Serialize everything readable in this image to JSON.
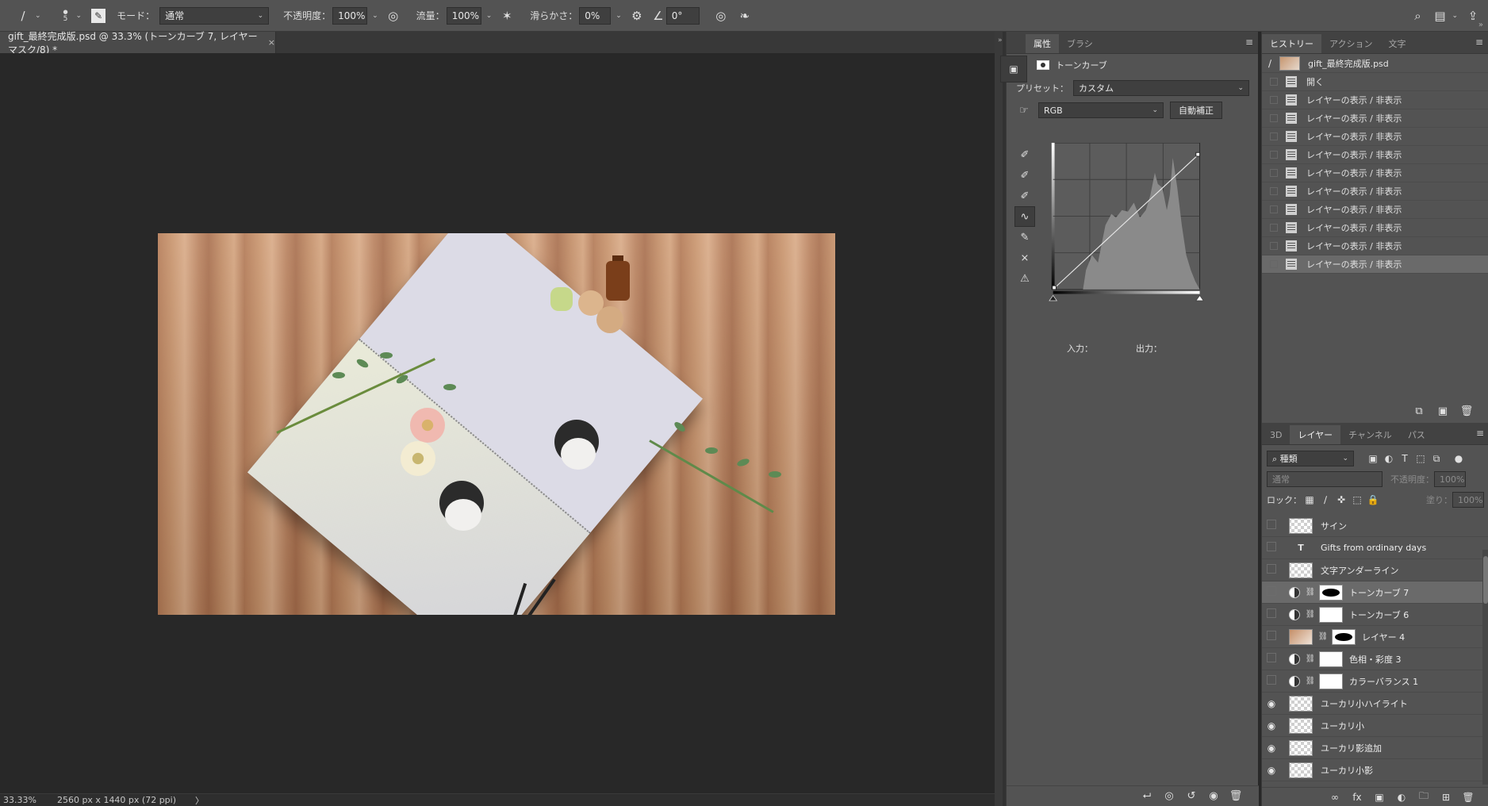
{
  "options_bar": {
    "brush_size": "5",
    "mode_label": "モード：",
    "mode_value": "通常",
    "opacity_label": "不透明度：",
    "opacity_value": "100%",
    "flow_label": "流量：",
    "flow_value": "100%",
    "smoothing_label": "滑らかさ：",
    "smoothing_value": "0%",
    "angle_value": "0°"
  },
  "document_tab": {
    "title": "gift_最終完成版.psd @ 33.3% (トーンカーブ 7, レイヤーマスク/8) *",
    "close": "×"
  },
  "status_bar": {
    "zoom": "33.33%",
    "doc_size": "2560 px x 1440 px (72 ppi)",
    "arrow": "〉"
  },
  "properties_panel": {
    "tabs": [
      "属性",
      "ブラシ"
    ],
    "header_label": "トーンカーブ",
    "preset_label": "プリセット：",
    "preset_value": "カスタム",
    "channel_value": "RGB",
    "auto_button": "自動補正",
    "input_label": "入力：",
    "output_label": "出力："
  },
  "history_panel": {
    "tabs": [
      "ヒストリー",
      "アクション",
      "文字"
    ],
    "snapshot": "gift_最終完成版.psd",
    "items": [
      {
        "label": "開く",
        "selected": false
      },
      {
        "label": "レイヤーの表示 / 非表示",
        "selected": false
      },
      {
        "label": "レイヤーの表示 / 非表示",
        "selected": false
      },
      {
        "label": "レイヤーの表示 / 非表示",
        "selected": false
      },
      {
        "label": "レイヤーの表示 / 非表示",
        "selected": false
      },
      {
        "label": "レイヤーの表示 / 非表示",
        "selected": false
      },
      {
        "label": "レイヤーの表示 / 非表示",
        "selected": false
      },
      {
        "label": "レイヤーの表示 / 非表示",
        "selected": false
      },
      {
        "label": "レイヤーの表示 / 非表示",
        "selected": false
      },
      {
        "label": "レイヤーの表示 / 非表示",
        "selected": false
      },
      {
        "label": "レイヤーの表示 / 非表示",
        "selected": true
      }
    ]
  },
  "layers_panel": {
    "tabs": [
      "3D",
      "レイヤー",
      "チャンネル",
      "パス"
    ],
    "filter_value": "種類",
    "blend_value": "通常",
    "opacity_label": "不透明度：",
    "opacity_value": "100%",
    "lock_label": "ロック：",
    "fill_label": "塗り：",
    "fill_value": "100%",
    "layers": [
      {
        "name": "サイン",
        "kind": "pixel",
        "visible": false,
        "selected": false
      },
      {
        "name": "Gifts from ordinary days",
        "kind": "text",
        "visible": false,
        "selected": false
      },
      {
        "name": "文字アンダーライン",
        "kind": "pixel",
        "visible": false,
        "selected": false
      },
      {
        "name": "トーンカーブ 7",
        "kind": "adjustment-dark-mask",
        "visible": false,
        "selected": true
      },
      {
        "name": "トーンカーブ 6",
        "kind": "adjustment",
        "visible": false,
        "selected": false
      },
      {
        "name": "レイヤー 4",
        "kind": "photo",
        "visible": false,
        "selected": false
      },
      {
        "name": "色相・彩度 3",
        "kind": "adjustment",
        "visible": false,
        "selected": false
      },
      {
        "name": "カラーバランス 1",
        "kind": "adjustment",
        "visible": false,
        "selected": false
      },
      {
        "name": "ユーカリ小ハイライト",
        "kind": "pixel",
        "visible": true,
        "selected": false
      },
      {
        "name": "ユーカリ小",
        "kind": "pixel",
        "visible": true,
        "selected": false
      },
      {
        "name": "ユーカリ影追加",
        "kind": "pixel",
        "visible": true,
        "selected": false
      },
      {
        "name": "ユーカリ小影",
        "kind": "pixel",
        "visible": true,
        "selected": false
      }
    ]
  }
}
